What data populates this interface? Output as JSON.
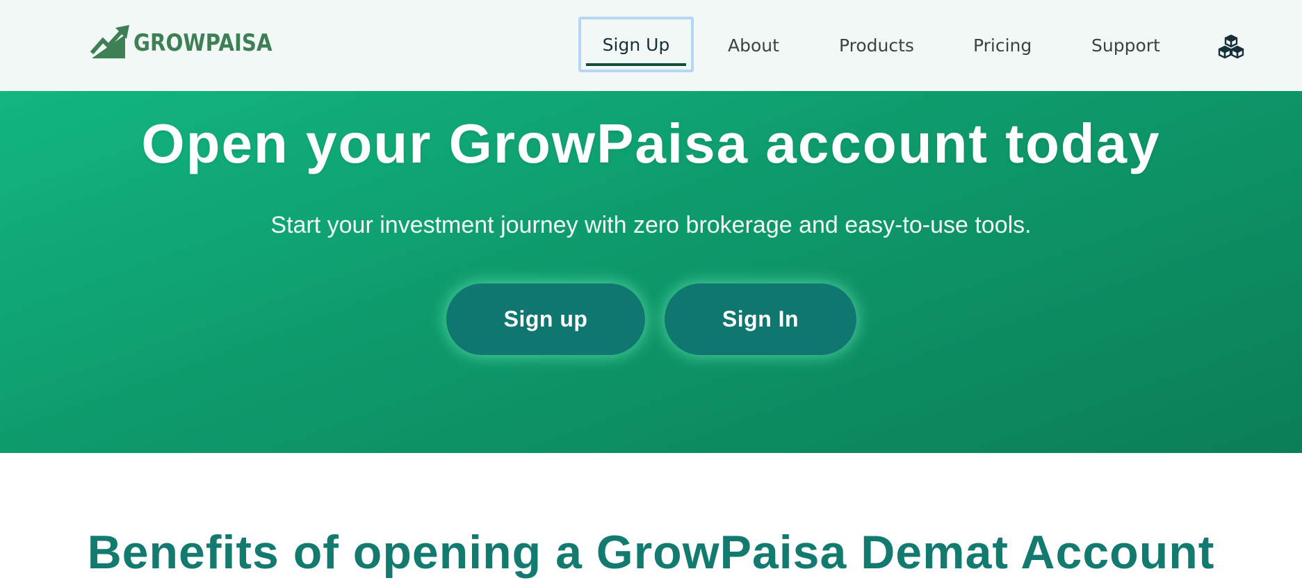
{
  "brand": {
    "name": "GROWPAISA",
    "primary_color": "#3f7f56",
    "accent_color": "#107670"
  },
  "nav": {
    "items": [
      {
        "label": "Sign Up",
        "active": true
      },
      {
        "label": "About"
      },
      {
        "label": "Products"
      },
      {
        "label": "Pricing"
      },
      {
        "label": "Support"
      }
    ],
    "extra_icon": "cubes-icon"
  },
  "hero": {
    "title": "Open your GrowPaisa account today",
    "subtitle": "Start your investment journey with zero brokerage and easy-to-use tools.",
    "signup_label": "Sign up",
    "signin_label": "Sign In",
    "background_color": "#0e9a6c"
  },
  "benefits": {
    "title": "Benefits of opening a GrowPaisa Demat Account"
  }
}
